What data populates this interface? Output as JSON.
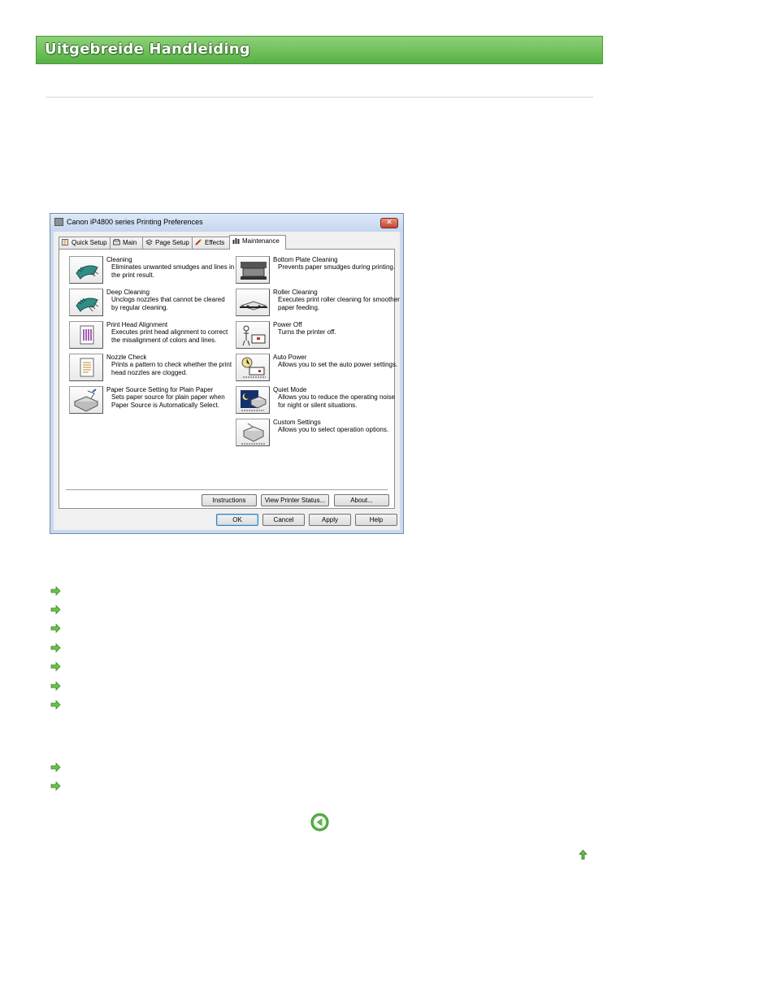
{
  "header": {
    "title": "Uitgebreide Handleiding"
  },
  "dialog": {
    "title": "Canon iP4800 series Printing Preferences",
    "close_symbol": "✕",
    "tabs": [
      {
        "label": "Quick Setup",
        "icon": "quick-setup-icon"
      },
      {
        "label": "Main",
        "icon": "main-icon"
      },
      {
        "label": "Page Setup",
        "icon": "page-setup-icon"
      },
      {
        "label": "Effects",
        "icon": "effects-icon"
      },
      {
        "label": "Maintenance",
        "icon": "maintenance-icon"
      }
    ],
    "left_items": [
      {
        "title": "Cleaning",
        "desc": [
          "Eliminates unwanted smudges and lines in",
          "the print result."
        ],
        "icon": "cleaning-icon"
      },
      {
        "title": "Deep Cleaning",
        "desc": [
          "Unclogs nozzles that cannot be cleared",
          "by regular cleaning."
        ],
        "icon": "deep-cleaning-icon"
      },
      {
        "title": "Print Head Alignment",
        "desc": [
          "Executes print head alignment to correct",
          "the misalignment of colors and lines."
        ],
        "icon": "print-head-alignment-icon"
      },
      {
        "title": "Nozzle Check",
        "desc": [
          "Prints a pattern to check whether the print",
          "head nozzles are clogged."
        ],
        "icon": "nozzle-check-icon"
      },
      {
        "title": "Paper Source Setting for Plain Paper",
        "desc": [
          "Sets paper source for plain paper when",
          "Paper Source is Automatically Select."
        ],
        "icon": "paper-source-icon"
      }
    ],
    "right_items": [
      {
        "title": "Bottom Plate Cleaning",
        "desc": [
          "Prevents paper smudges during printing."
        ],
        "icon": "bottom-plate-cleaning-icon"
      },
      {
        "title": "Roller Cleaning",
        "desc": [
          "Executes print roller cleaning for smoother",
          "paper feeding."
        ],
        "icon": "roller-cleaning-icon"
      },
      {
        "title": "Power Off",
        "desc": [
          "Turns the printer off."
        ],
        "icon": "power-off-icon"
      },
      {
        "title": "Auto Power",
        "desc": [
          "Allows you to set the auto power settings."
        ],
        "icon": "auto-power-icon"
      },
      {
        "title": "Quiet Mode",
        "desc": [
          "Allows you to reduce the operating noise",
          "for night or silent situations."
        ],
        "icon": "quiet-mode-icon"
      },
      {
        "title": "Custom Settings",
        "desc": [
          "Allows you to select operation options."
        ],
        "icon": "custom-settings-icon"
      }
    ],
    "panel_buttons": {
      "instructions": "Instructions",
      "view_status": "View Printer Status...",
      "about": "About..."
    },
    "footer_buttons": {
      "ok": "OK",
      "cancel": "Cancel",
      "apply": "Apply",
      "help": "Help"
    }
  },
  "colors": {
    "banner": "#6fc05a",
    "arrow": "#6cc04a",
    "title_bar": "#c9daf0"
  },
  "icons": {
    "link_arrow": "arrow-right-icon",
    "back": "back-icon",
    "top": "page-top-icon"
  }
}
